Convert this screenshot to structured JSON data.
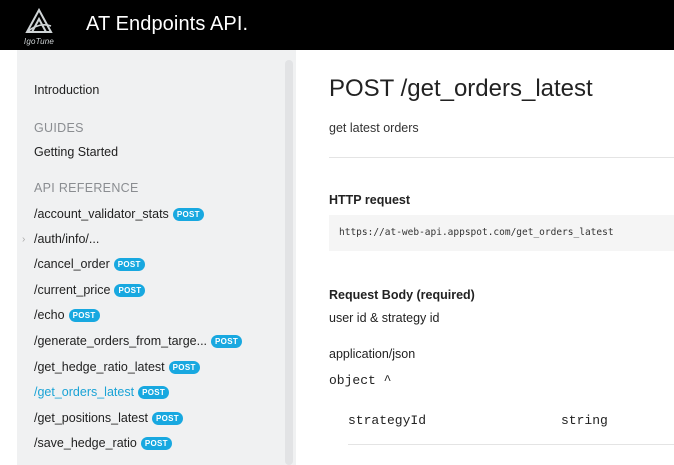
{
  "header": {
    "app_title": "AT Endpoints API.",
    "logo_text": "IgoTune",
    "logo_icon": "igotune-logo-icon"
  },
  "sidebar": {
    "introduction": "Introduction",
    "guides_heading": "GUIDES",
    "getting_started": "Getting Started",
    "api_reference_heading": "API REFERENCE",
    "items": [
      {
        "label": "/account_validator_stats",
        "badge": "POST"
      },
      {
        "label": "/auth/info/...",
        "badge": ""
      },
      {
        "label": "/cancel_order",
        "badge": "POST"
      },
      {
        "label": "/current_price",
        "badge": "POST"
      },
      {
        "label": "/echo",
        "badge": "POST"
      },
      {
        "label": "/generate_orders_from_targe...",
        "badge": "POST"
      },
      {
        "label": "/get_hedge_ratio_latest",
        "badge": "POST"
      },
      {
        "label": "/get_orders_latest",
        "badge": "POST",
        "active": true
      },
      {
        "label": "/get_positions_latest",
        "badge": "POST"
      },
      {
        "label": "/save_hedge_ratio",
        "badge": "POST"
      }
    ]
  },
  "main": {
    "title": "POST /get_orders_latest",
    "subtitle": "get latest orders",
    "http_request_heading": "HTTP request",
    "http_request_url": "https://at-web-api.appspot.com/get_orders_latest",
    "request_body_heading": "Request Body (required)",
    "request_body_desc": "user id & strategy id",
    "content_type": "application/json",
    "object_label": "object ^",
    "fields": [
      {
        "name": "strategyId",
        "type": "string"
      }
    ]
  },
  "colors": {
    "header_bg": "#000000",
    "sidebar_bg": "#f0f1f2",
    "accent": "#18a8e0",
    "active_link": "#1aa3d6"
  }
}
